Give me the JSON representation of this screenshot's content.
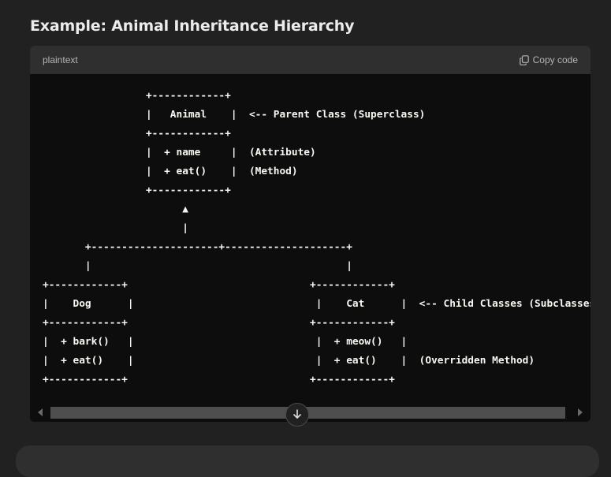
{
  "heading": "Example: Animal Inheritance Hierarchy",
  "code_block": {
    "language": "plaintext",
    "copy_label": "Copy code",
    "code": "                 +------------+\n                 |   Animal    |  <-- Parent Class (Superclass)\n                 +------------+\n                 |  + name     |  (Attribute)\n                 |  + eat()    |  (Method)\n                 +------------+\n                       ▲\n                       |\n       +---------------------+--------------------+\n       |                                          |\n+------------+                              +------------+\n|    Dog      |                              |    Cat      |  <-- Child Classes (Subclasses)\n+------------+                              +------------+\n|  + bark()   |                              |  + meow()   |\n|  + eat()    |                              |  + eat()    |  (Overridden Method)\n+------------+                              +------------+"
  },
  "icons": {
    "copy": "copy-icon",
    "scroll_down": "arrow-down-icon"
  }
}
